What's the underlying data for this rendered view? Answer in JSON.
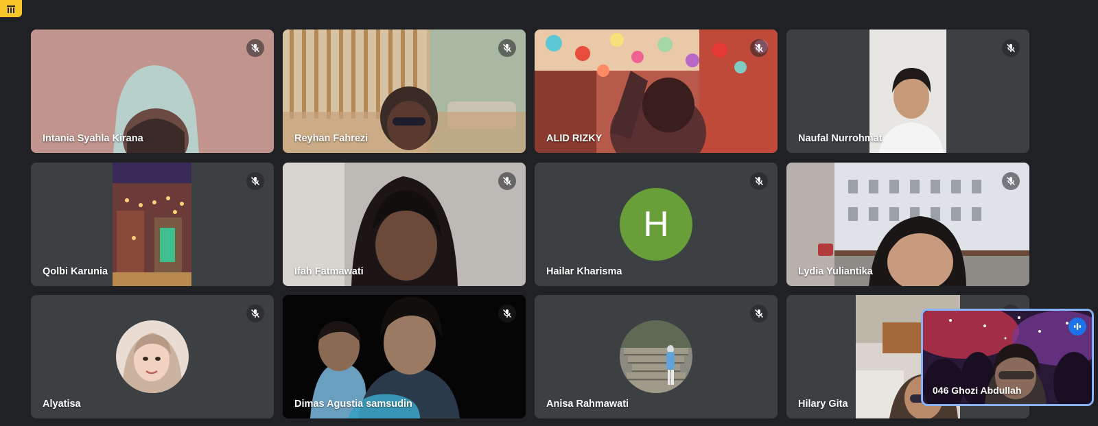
{
  "meeting": {
    "participants": [
      {
        "name": "Intania Syahla Kirana",
        "tile": "camera",
        "muted": true
      },
      {
        "name": "Reyhan Fahrezi",
        "tile": "camera",
        "muted": true
      },
      {
        "name": "ALID RIZKY",
        "tile": "camera",
        "muted": true
      },
      {
        "name": "Naufal Nurrohmat",
        "tile": "camera",
        "muted": true
      },
      {
        "name": "Qolbi Karunia",
        "tile": "camera",
        "muted": true
      },
      {
        "name": "Ifah Fatmawati",
        "tile": "camera",
        "muted": true
      },
      {
        "name": "Hailar Kharisma",
        "tile": "avatar-letter",
        "avatar_letter": "H",
        "avatar_color": "#689f38",
        "muted": true
      },
      {
        "name": "Lydia Yuliantika",
        "tile": "camera",
        "muted": true
      },
      {
        "name": "Alyatisa",
        "tile": "avatar-photo",
        "muted": true
      },
      {
        "name": "Dimas Agustia samsudin",
        "tile": "camera",
        "muted": true
      },
      {
        "name": "Anisa Rahmawati",
        "tile": "avatar-photo",
        "muted": true
      },
      {
        "name": "Hilary Gita",
        "tile": "camera",
        "muted": true
      }
    ],
    "self_view": {
      "name": "046 Ghozi Abdullah",
      "speaking": true
    }
  },
  "icons": {
    "muted": "mic-off-icon",
    "speaking": "audio-level-icon",
    "corner": "bookmark-grid-icon"
  },
  "colors": {
    "background": "#202124",
    "tile": "#3c4043",
    "self_view_border": "#8ab4f8",
    "speaking_badge": "#1a73e8",
    "corner_badge": "#f9c72a"
  }
}
